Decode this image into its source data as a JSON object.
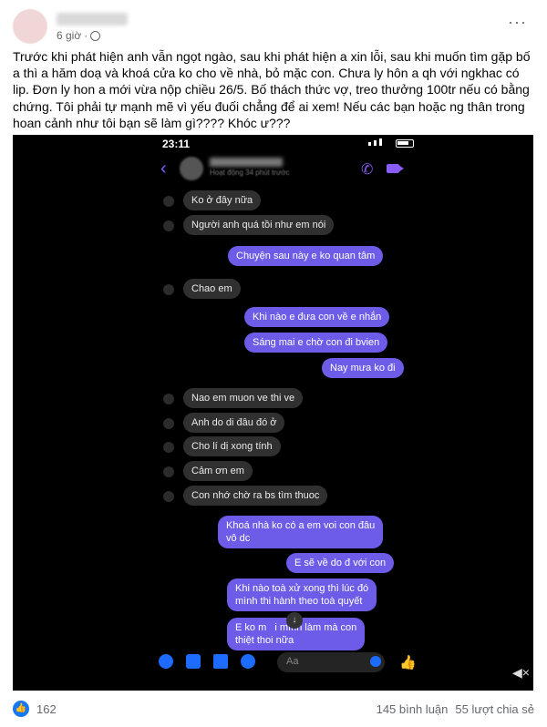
{
  "post": {
    "time": "6 giờ",
    "text": "Trước khi phát hiện anh vẫn ngọt ngào, sau khi phát hiện a xin lỗi, sau khi muốn tìm gặp bố a thì a hăm doạ và khoá cửa ko cho về nhà, bỏ mặc con. Chưa ly hôn a qh với ngkhac có lip. Đơn ly hon a mới vừa nộp chiều 26/5. Bố thách thức vợ, treo thưởng 100tr nếu có bằng chứng. Tôi phải tự mạnh mẽ vì yếu đuối chẳng để ai xem! Nếu các bạn hoặc ng thân trong hoan cảnh như tôi bạn sẽ làm gì???? Khóc ư???",
    "more_label": "···"
  },
  "screenshot": {
    "status_time": "23:11",
    "contact_status": "Hoạt động 34 phút trước",
    "messages": [
      {
        "dir": "in",
        "text": "Ko ở đây nữa"
      },
      {
        "dir": "in",
        "text": "Người anh quá tồi như em nói"
      },
      {
        "dir": "out",
        "text": "Chuyện sau này e ko quan tâm"
      },
      {
        "dir": "in",
        "text": "Chao em"
      },
      {
        "dir": "out",
        "text": "Khi nào e đưa con về e nhắn"
      },
      {
        "dir": "out",
        "text": "Sáng mai e chờ con đi bvien"
      },
      {
        "dir": "out",
        "text": "Nay mưa ko đi"
      },
      {
        "dir": "in",
        "text": "Nao em muon ve thi ve"
      },
      {
        "dir": "in",
        "text": "Anh do di đâu đó ở"
      },
      {
        "dir": "in",
        "text": "Cho lí dị xong tính"
      },
      {
        "dir": "in",
        "text": "Cảm ơn em"
      },
      {
        "dir": "in",
        "text": "Con nhớ chờ ra bs tìm thuoc"
      },
      {
        "dir": "out",
        "text": "Khoá nhà ko có a em voi con đâu\nvô dc"
      },
      {
        "dir": "out",
        "text": "E sẽ về do đ với con"
      },
      {
        "dir": "out",
        "text": "Khi nào toà xử xong thì lúc đó\nmình thi hành theo toà quyết"
      },
      {
        "dir": "out",
        "text": "E ko m   i mình làm mà con\nthiệt thoi nữa"
      }
    ],
    "input_placeholder": "Aa"
  },
  "footer": {
    "likes": "162",
    "comments": "145 bình luận",
    "shares": "55 lượt chia sẻ"
  },
  "colors": {
    "outgoing": "#6c5ce7",
    "incoming": "#303030",
    "accent": "#1877f2"
  }
}
